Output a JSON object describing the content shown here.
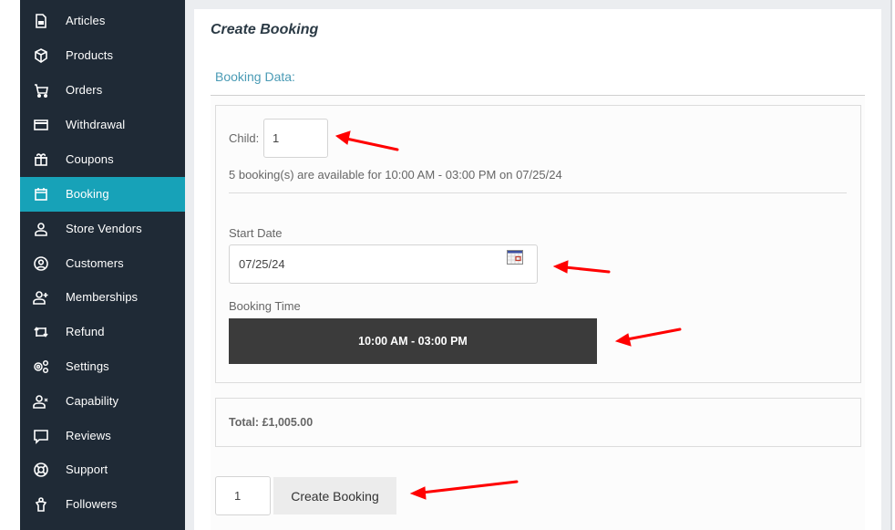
{
  "sidebar": {
    "items": [
      {
        "label": "Articles",
        "icon": "article-icon"
      },
      {
        "label": "Products",
        "icon": "cube-icon"
      },
      {
        "label": "Orders",
        "icon": "cart-icon"
      },
      {
        "label": "Withdrawal",
        "icon": "credit-card-icon"
      },
      {
        "label": "Coupons",
        "icon": "gift-icon"
      },
      {
        "label": "Booking",
        "icon": "calendar-icon",
        "active": true
      },
      {
        "label": "Store Vendors",
        "icon": "user-icon"
      },
      {
        "label": "Customers",
        "icon": "user-circle-icon"
      },
      {
        "label": "Memberships",
        "icon": "user-plus-icon"
      },
      {
        "label": "Refund",
        "icon": "repeat-icon"
      },
      {
        "label": "Settings",
        "icon": "cogs-icon"
      },
      {
        "label": "Capability",
        "icon": "user-times-icon"
      },
      {
        "label": "Reviews",
        "icon": "comment-icon"
      },
      {
        "label": "Support",
        "icon": "lifebuoy-icon"
      },
      {
        "label": "Followers",
        "icon": "follower-icon"
      }
    ],
    "active_color": "#17a2b8",
    "bg_color": "#1f2a36"
  },
  "main": {
    "title": "Create Booking",
    "section_label": "Booking Data:",
    "child_label": "Child:",
    "child_value": "1",
    "availability_text": "5 booking(s) are available for 10:00 AM - 03:00 PM on 07/25/24",
    "start_date_label": "Start Date",
    "start_date_value": "07/25/24",
    "booking_time_label": "Booking Time",
    "booking_time_slot": "10:00 AM - 03:00 PM",
    "total_text": "Total: £1,005.00",
    "quantity_value": "1",
    "create_button_label": "Create Booking"
  },
  "annotations": {
    "arrow_color": "#ff0000"
  }
}
